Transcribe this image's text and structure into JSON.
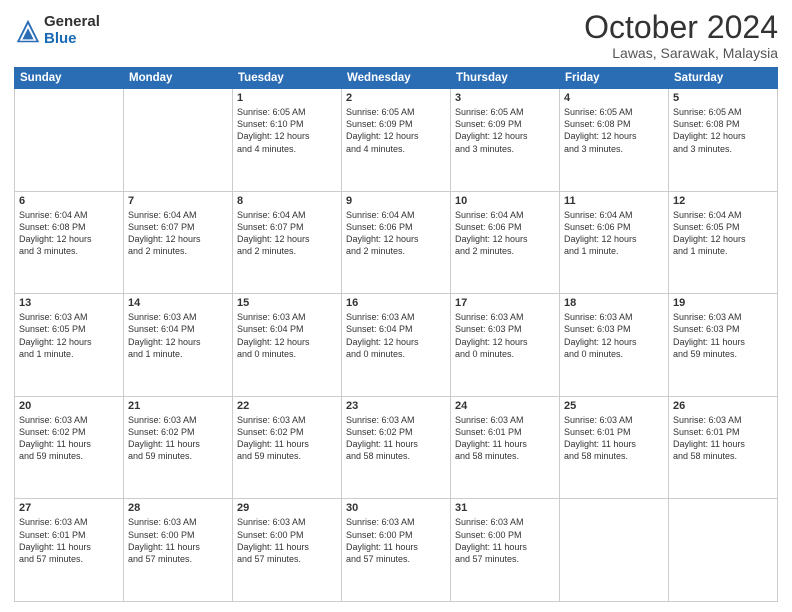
{
  "logo": {
    "general": "General",
    "blue": "Blue"
  },
  "header": {
    "month": "October 2024",
    "location": "Lawas, Sarawak, Malaysia"
  },
  "weekdays": [
    "Sunday",
    "Monday",
    "Tuesday",
    "Wednesday",
    "Thursday",
    "Friday",
    "Saturday"
  ],
  "weeks": [
    [
      {
        "day": "",
        "text": ""
      },
      {
        "day": "",
        "text": ""
      },
      {
        "day": "1",
        "text": "Sunrise: 6:05 AM\nSunset: 6:10 PM\nDaylight: 12 hours\nand 4 minutes."
      },
      {
        "day": "2",
        "text": "Sunrise: 6:05 AM\nSunset: 6:09 PM\nDaylight: 12 hours\nand 4 minutes."
      },
      {
        "day": "3",
        "text": "Sunrise: 6:05 AM\nSunset: 6:09 PM\nDaylight: 12 hours\nand 3 minutes."
      },
      {
        "day": "4",
        "text": "Sunrise: 6:05 AM\nSunset: 6:08 PM\nDaylight: 12 hours\nand 3 minutes."
      },
      {
        "day": "5",
        "text": "Sunrise: 6:05 AM\nSunset: 6:08 PM\nDaylight: 12 hours\nand 3 minutes."
      }
    ],
    [
      {
        "day": "6",
        "text": "Sunrise: 6:04 AM\nSunset: 6:08 PM\nDaylight: 12 hours\nand 3 minutes."
      },
      {
        "day": "7",
        "text": "Sunrise: 6:04 AM\nSunset: 6:07 PM\nDaylight: 12 hours\nand 2 minutes."
      },
      {
        "day": "8",
        "text": "Sunrise: 6:04 AM\nSunset: 6:07 PM\nDaylight: 12 hours\nand 2 minutes."
      },
      {
        "day": "9",
        "text": "Sunrise: 6:04 AM\nSunset: 6:06 PM\nDaylight: 12 hours\nand 2 minutes."
      },
      {
        "day": "10",
        "text": "Sunrise: 6:04 AM\nSunset: 6:06 PM\nDaylight: 12 hours\nand 2 minutes."
      },
      {
        "day": "11",
        "text": "Sunrise: 6:04 AM\nSunset: 6:06 PM\nDaylight: 12 hours\nand 1 minute."
      },
      {
        "day": "12",
        "text": "Sunrise: 6:04 AM\nSunset: 6:05 PM\nDaylight: 12 hours\nand 1 minute."
      }
    ],
    [
      {
        "day": "13",
        "text": "Sunrise: 6:03 AM\nSunset: 6:05 PM\nDaylight: 12 hours\nand 1 minute."
      },
      {
        "day": "14",
        "text": "Sunrise: 6:03 AM\nSunset: 6:04 PM\nDaylight: 12 hours\nand 1 minute."
      },
      {
        "day": "15",
        "text": "Sunrise: 6:03 AM\nSunset: 6:04 PM\nDaylight: 12 hours\nand 0 minutes."
      },
      {
        "day": "16",
        "text": "Sunrise: 6:03 AM\nSunset: 6:04 PM\nDaylight: 12 hours\nand 0 minutes."
      },
      {
        "day": "17",
        "text": "Sunrise: 6:03 AM\nSunset: 6:03 PM\nDaylight: 12 hours\nand 0 minutes."
      },
      {
        "day": "18",
        "text": "Sunrise: 6:03 AM\nSunset: 6:03 PM\nDaylight: 12 hours\nand 0 minutes."
      },
      {
        "day": "19",
        "text": "Sunrise: 6:03 AM\nSunset: 6:03 PM\nDaylight: 11 hours\nand 59 minutes."
      }
    ],
    [
      {
        "day": "20",
        "text": "Sunrise: 6:03 AM\nSunset: 6:02 PM\nDaylight: 11 hours\nand 59 minutes."
      },
      {
        "day": "21",
        "text": "Sunrise: 6:03 AM\nSunset: 6:02 PM\nDaylight: 11 hours\nand 59 minutes."
      },
      {
        "day": "22",
        "text": "Sunrise: 6:03 AM\nSunset: 6:02 PM\nDaylight: 11 hours\nand 59 minutes."
      },
      {
        "day": "23",
        "text": "Sunrise: 6:03 AM\nSunset: 6:02 PM\nDaylight: 11 hours\nand 58 minutes."
      },
      {
        "day": "24",
        "text": "Sunrise: 6:03 AM\nSunset: 6:01 PM\nDaylight: 11 hours\nand 58 minutes."
      },
      {
        "day": "25",
        "text": "Sunrise: 6:03 AM\nSunset: 6:01 PM\nDaylight: 11 hours\nand 58 minutes."
      },
      {
        "day": "26",
        "text": "Sunrise: 6:03 AM\nSunset: 6:01 PM\nDaylight: 11 hours\nand 58 minutes."
      }
    ],
    [
      {
        "day": "27",
        "text": "Sunrise: 6:03 AM\nSunset: 6:01 PM\nDaylight: 11 hours\nand 57 minutes."
      },
      {
        "day": "28",
        "text": "Sunrise: 6:03 AM\nSunset: 6:00 PM\nDaylight: 11 hours\nand 57 minutes."
      },
      {
        "day": "29",
        "text": "Sunrise: 6:03 AM\nSunset: 6:00 PM\nDaylight: 11 hours\nand 57 minutes."
      },
      {
        "day": "30",
        "text": "Sunrise: 6:03 AM\nSunset: 6:00 PM\nDaylight: 11 hours\nand 57 minutes."
      },
      {
        "day": "31",
        "text": "Sunrise: 6:03 AM\nSunset: 6:00 PM\nDaylight: 11 hours\nand 57 minutes."
      },
      {
        "day": "",
        "text": ""
      },
      {
        "day": "",
        "text": ""
      }
    ]
  ]
}
